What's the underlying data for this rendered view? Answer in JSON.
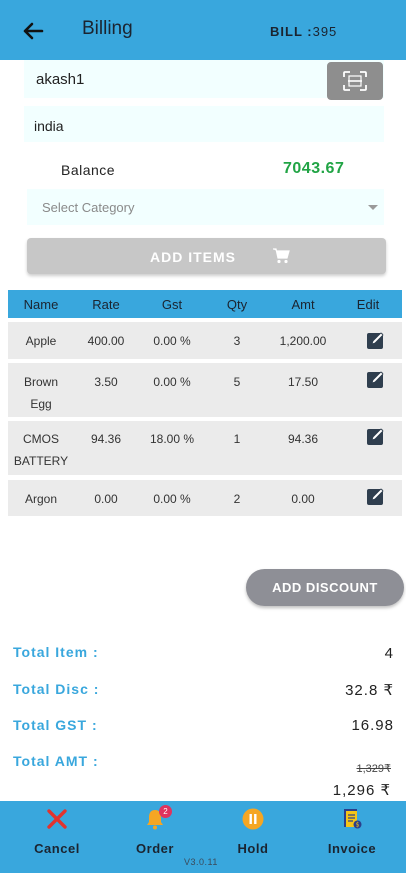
{
  "header": {
    "title": "Billing",
    "bill_label": "BILL :",
    "bill_number": "395"
  },
  "customer": {
    "name": "akash1",
    "country": "india"
  },
  "balance": {
    "label": "Balance",
    "value": "7043.67"
  },
  "category": {
    "placeholder": "Select Category"
  },
  "add_items": {
    "label": "ADD ITEMS"
  },
  "table": {
    "columns": [
      "Name",
      "Rate",
      "Gst",
      "Qty",
      "Amt",
      "Edit"
    ],
    "rows": [
      {
        "name_line1": "Apple",
        "name_line2": "",
        "rate": "400.00",
        "gst": "0.00 %",
        "qty": "3",
        "amt": "1,200.00"
      },
      {
        "name_line1": "Brown",
        "name_line2": "Egg",
        "rate": "3.50",
        "gst": "0.00 %",
        "qty": "5",
        "amt": "17.50"
      },
      {
        "name_line1": "CMOS",
        "name_line2": "BATTERY",
        "rate": "94.36",
        "gst": "18.00 %",
        "qty": "1",
        "amt": "94.36"
      },
      {
        "name_line1": "Argon",
        "name_line2": "",
        "rate": "0.00",
        "gst": "0.00 %",
        "qty": "2",
        "amt": "0.00"
      }
    ]
  },
  "discount": {
    "label": "ADD DISCOUNT"
  },
  "totals": {
    "item_label": "Total Item :",
    "item_value": "4",
    "disc_label": "Total Disc :",
    "disc_value": "32.8 ₹",
    "gst_label": "Total GST :",
    "gst_value": "16.98",
    "amt_label": "Total AMT :",
    "amt_original": "1,329₹",
    "amt_final": "1,296 ₹"
  },
  "bottom_nav": {
    "cancel": "Cancel",
    "order": "Order",
    "order_badge": "2",
    "hold": "Hold",
    "invoice": "Invoice"
  },
  "version": "V3.0.11",
  "colors": {
    "accent": "#39a7dd",
    "balance": "#21a445",
    "cancel": "#e2332f",
    "hold": "#f5a623",
    "badge": "#e0335e"
  }
}
